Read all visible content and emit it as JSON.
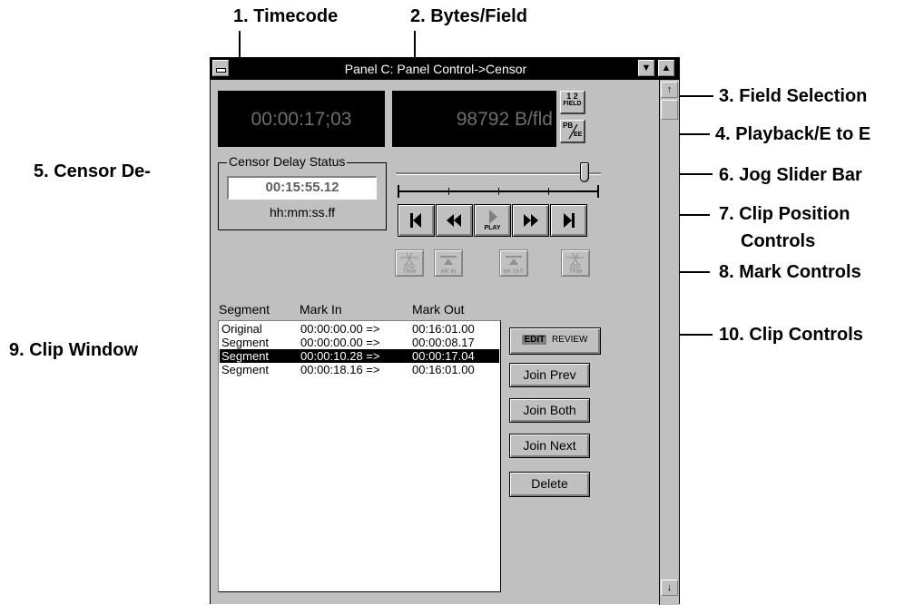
{
  "callouts": {
    "timecode": "1. Timecode",
    "bytes_field": "2. Bytes/Field",
    "field_selection": "3. Field Selection",
    "playback_e_to_e": "4. Playback/E to E",
    "censor_delay": "5. Censor De-",
    "jog_slider": "6. Jog Slider Bar",
    "clip_position_1": "7. Clip Position",
    "clip_position_2": "Controls",
    "mark_controls": "8. Mark Controls",
    "clip_window": "9. Clip Window",
    "clip_controls": "10. Clip Controls"
  },
  "window": {
    "title": "Panel C: Panel Control->Censor",
    "timecode": "00:00:17;03",
    "bytes_per_field": "98792 B/fld",
    "field_btn_top": "1 2",
    "field_btn_bottom": "FIELD",
    "pbee_btn_top": "PB",
    "pbee_btn_bottom": "EE",
    "censor_group_label": "Censor Delay Status",
    "censor_delay_value": "00:15:55.12",
    "censor_delay_format": "hh:mm:ss.ff",
    "play_label": "PLAY",
    "mark_labels": [
      "TRIM",
      "MK IN",
      "MK OUT",
      "TRIM"
    ],
    "segments_header": {
      "col1": "Segment",
      "col2": "Mark In",
      "col3": "Mark Out"
    },
    "segments": [
      {
        "name": "Original",
        "mark_in": "00:00:00.00 =>",
        "mark_out": "00:16:01.00",
        "selected": false
      },
      {
        "name": "Segment",
        "mark_in": "00:00:00.00 =>",
        "mark_out": "00:00:08.17",
        "selected": false
      },
      {
        "name": "Segment",
        "mark_in": "00:00:10.28 =>",
        "mark_out": "00:00:17.04",
        "selected": true
      },
      {
        "name": "Segment",
        "mark_in": "00:00:18.16 =>",
        "mark_out": "00:16:01.00",
        "selected": false
      }
    ],
    "edit_label": "EDIT",
    "review_label": "REVIEW",
    "join_prev": "Join Prev",
    "join_both": "Join Both",
    "join_next": "Join Next",
    "delete": "Delete"
  },
  "jog_slider_position": 0.94
}
